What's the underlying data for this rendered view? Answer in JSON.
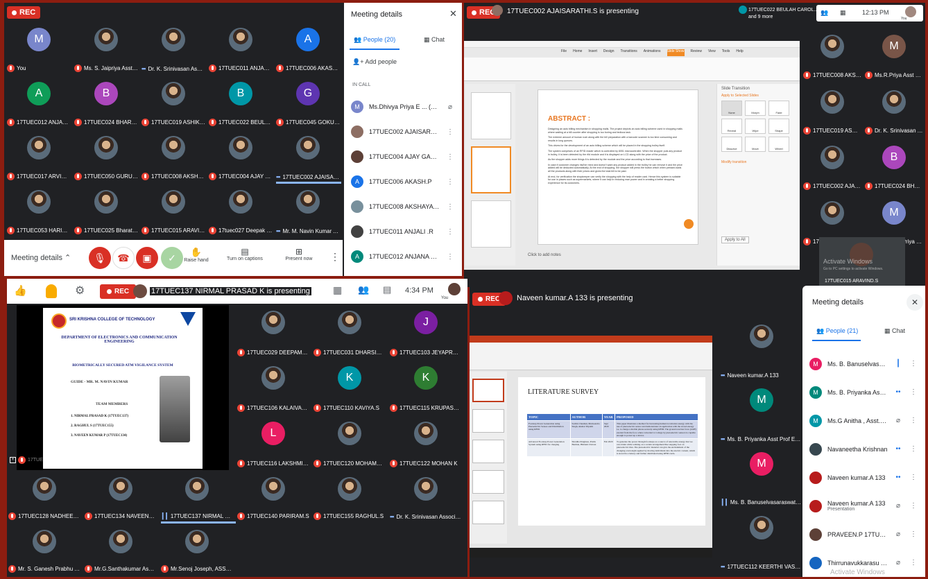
{
  "q1": {
    "rec": "REC",
    "meeting_details": "Meeting details",
    "side_title": "Meeting details",
    "people_tab": "People (20)",
    "chat_tab": "Chat",
    "add_people": "Add people",
    "in_call": "IN CALL",
    "people": [
      {
        "name": "Ms.Dhivya Priya E ... (You)",
        "initial": "M",
        "color": "#7986cb"
      },
      {
        "name": "17TUEC002 AJAISARAT...",
        "initial": "",
        "color": "#8d6e63"
      },
      {
        "name": "17TUEC004 AJAY GAUT...",
        "initial": "",
        "color": "#5d4037"
      },
      {
        "name": "17TUEC006 AKASH.P",
        "initial": "A",
        "color": "#1a73e8"
      },
      {
        "name": "17TUEC008 AKSHAYA K...",
        "initial": "",
        "color": "#78909c"
      },
      {
        "name": "17TUEC011 ANJALI .R",
        "initial": "",
        "color": "#424242"
      },
      {
        "name": "17TUEC012 ANJANA ME...",
        "initial": "A",
        "color": "#00897b"
      }
    ],
    "tiles": [
      {
        "name": "You",
        "initial": "M",
        "color": "#7986cb",
        "ind": "mic"
      },
      {
        "name": "Ms. S. Jaipriya Asst Pr...",
        "initial": "",
        "color": "",
        "ind": "mic"
      },
      {
        "name": "Dr. K. Srinivasan Asso...",
        "initial": "",
        "color": "",
        "ind": "dots"
      },
      {
        "name": "17TUEC011 ANJALI .R",
        "initial": "",
        "color": "",
        "ind": "mic"
      },
      {
        "name": "17TUEC006 AKASH.P",
        "initial": "A",
        "color": "#1a73e8",
        "ind": "mic"
      },
      {
        "name": "17TUEC012 ANJANA ...",
        "initial": "A",
        "color": "#0f9d58",
        "ind": "mic"
      },
      {
        "name": "17TUEC024 BHARATH...",
        "initial": "B",
        "color": "#ab47bc",
        "ind": "mic"
      },
      {
        "name": "17TUEC019 ASHIKHA.E",
        "initial": "",
        "color": "",
        "ind": "mic"
      },
      {
        "name": "17TUEC022 BEULAH ...",
        "initial": "B",
        "color": "#0097a7",
        "ind": "mic"
      },
      {
        "name": "17TUEC045 GOKUL R...",
        "initial": "G",
        "color": "#5e35b1",
        "ind": "mic"
      },
      {
        "name": "17TUEC017 ARVIND.P",
        "initial": "",
        "color": "",
        "ind": "mic"
      },
      {
        "name": "17TUEC050 GURUVIS...",
        "initial": "",
        "color": "",
        "ind": "mic"
      },
      {
        "name": "17TUEC008 AKSHAYA...",
        "initial": "",
        "color": "",
        "ind": "mic"
      },
      {
        "name": "17TUEC004 AJAY GA...",
        "initial": "",
        "color": "",
        "ind": "mic"
      },
      {
        "name": "17TUEC002 AJAISAR...",
        "initial": "",
        "color": "",
        "ind": "dots"
      },
      {
        "name": "17TUEC053 HARISH B...",
        "initial": "",
        "color": "",
        "ind": "mic"
      },
      {
        "name": "17TUEC025 Bharathi.G",
        "initial": "",
        "color": "",
        "ind": "mic"
      },
      {
        "name": "17TUEC015 ARAVIND.S",
        "initial": "",
        "color": "",
        "ind": "mic"
      },
      {
        "name": "17tuec027 Deepak no...",
        "initial": "",
        "color": "",
        "ind": "mic"
      },
      {
        "name": "Mr. M. Navin Kumar A...",
        "initial": "",
        "color": "",
        "ind": "dots"
      }
    ],
    "controls": {
      "raise": "Raise hand",
      "captions": "Turn on captions",
      "present": "Present now"
    }
  },
  "q2": {
    "rec": "REC",
    "presenting": "17TUEC002 AJAISARATHI.S is presenting",
    "top_person": "17TUEC022 BEULAH CAROL...",
    "top_more": "and 9 more",
    "time": "12:13 PM",
    "you": "You",
    "slide_title": "ABSTRACT :",
    "bullets": [
      "Designing an auto billing mechanism in shopping malls. The project depicts an auto billing scheme used in shopping malls where waiting at a bill counter after shopping is too boring and tedious task.",
      "The extreme amount of human rush along with the bill preparation with a barcode scanner is too time consuming and results in long queues.",
      "This drives for the development of an auto billing scheme which will be placed in the shopping trolley itself.",
      "The system comprises of an RFID reader which is controlled by 8051 microcontroller. When the shopper puts any product in trolley, it is been detected by the rfid module and it is displayed on LCD along with the price of the product.",
      "As the shopper adds more things it is detected by the module and the price according to that increases.",
      "In case if customer changes his/her mind and doesn't want any product added in the trolley he can remove it and the price added will be deducted automatically. At the end of shopping, the shopper will press the button which when pressed adds all the products along with their prices and gives the total bill to be paid.",
      "At end, for verification the shopkeeper can verify the shopping with the help of reader card. Hence this system is suitable for use in places such as supermarkets, where it can help in reducing man power and in creating a better shopping experience for its customers."
    ],
    "ribbon_tabs": [
      "File",
      "Home",
      "Insert",
      "Design",
      "Transitions",
      "Animations",
      "Slide Show",
      "Review",
      "View",
      "Tools",
      "Help"
    ],
    "notes": "Click to add notes",
    "pane_title": "Slide Transition",
    "apply_label": "Apply to Selected Slides",
    "transitions": [
      "None",
      "Morph",
      "Fade",
      "Reveal",
      "Wipe",
      "Shape",
      "Dissolve",
      "Move",
      "Wheel"
    ],
    "modify": "Modify transition",
    "apply_all": "Apply to All",
    "tiles": [
      {
        "name": "17TUEC008 AKSHAYA ...",
        "initial": "",
        "color": "",
        "ind": "mic"
      },
      {
        "name": "Ms.R.Priya Asst Prof E...",
        "initial": "M",
        "color": "#795548",
        "ind": "mic"
      },
      {
        "name": "17TUEC019 ASHIKHA.E",
        "initial": "",
        "color": "",
        "ind": "mic"
      },
      {
        "name": "Dr. K. Srinivasan Associ...",
        "initial": "",
        "color": "",
        "ind": "mic"
      },
      {
        "name": "17TUEC002 AJAISARA...",
        "initial": "",
        "color": "",
        "ind": "mic"
      },
      {
        "name": "17TUEC024 BHARATH.P",
        "initial": "B",
        "color": "#ab47bc",
        "ind": "mic"
      },
      {
        "name": "17TUEC053 HARISH B...",
        "initial": "",
        "color": "",
        "ind": "mic"
      },
      {
        "name": "Ms Dhivya Priya E L As...",
        "initial": "M",
        "color": "#7986cb",
        "ind": "mic"
      }
    ],
    "bottom_tile": "17TUEC015 ARAVIND.S",
    "activate": "Activate Windows",
    "activate_sub": "Go to PC settings to activate Windows."
  },
  "q3": {
    "rec": "REC",
    "presenting": "17TUEC137 NIRMAL PRASAD K is presenting",
    "time": "4:34 PM",
    "you": "You",
    "college": "SRI KRISHNA COLLEGE OF TECHNOLOGY",
    "dept": "DEPARTMENT OF ELECTRONICS AND COMMUNICATION ENGINEERING",
    "project": "BIOMETRICALLY SECURED ATM VIGILANCE SYSTEM",
    "guide": "GUIDE - MR. M. NAVIN KUMAR",
    "team_title": "TEAM MEMBERS",
    "team": [
      "1.  NIRMAL PRASAD K (17TUEC137)",
      "2.  RAGHUL S (17TUEC155)",
      "3.  NAVEEN KUMAR P (17TUEC134)"
    ],
    "presenter_label": "17TUEC137 NIRMAL PRASAD K",
    "tiles": [
      {
        "name": "17TUEC029 DEEPAMURU...",
        "initial": "",
        "color": "",
        "ind": "mic"
      },
      {
        "name": "17TUEC031 DHARSINI.B",
        "initial": "",
        "color": "",
        "ind": "mic"
      },
      {
        "name": "17TUEC103 JEYAPRABHA...",
        "initial": "J",
        "color": "#7b1fa2",
        "ind": "mic"
      },
      {
        "name": "17TUEC106 KALAIVANI.K",
        "initial": "",
        "color": "",
        "ind": "mic"
      },
      {
        "name": "17TUEC110 KAVIYA.S",
        "initial": "K",
        "color": "#0097a7",
        "ind": "mic"
      },
      {
        "name": "17TUEC115 KRUPASREE.P",
        "initial": "K",
        "color": "#2e7d32",
        "ind": "mic"
      },
      {
        "name": "17TUEC116 LAKSHMI PR...",
        "initial": "L",
        "color": "#e91e63",
        "ind": "mic"
      },
      {
        "name": "17TUEC120 MOHAMED FI...",
        "initial": "",
        "color": "",
        "ind": "mic"
      },
      {
        "name": "17TUEC122 MOHAN K",
        "initial": "",
        "color": "",
        "ind": "mic"
      },
      {
        "name": "17TUEC128 NADHEERA.M",
        "initial": "",
        "color": "",
        "ind": "mic"
      },
      {
        "name": "17TUEC134 NAVEENKUM...",
        "initial": "",
        "color": "",
        "ind": "mic"
      },
      {
        "name": "17TUEC137 NIRMAL PRA...",
        "initial": "",
        "color": "",
        "ind": "bars"
      },
      {
        "name": "17TUEC140 PARIRAM.S",
        "initial": "",
        "color": "",
        "ind": "mic"
      },
      {
        "name": "17TUEC155 RAGHUL.S",
        "initial": "",
        "color": "",
        "ind": "mic"
      },
      {
        "name": "Dr. K. Srinivasan Associate...",
        "initial": "",
        "color": "",
        "ind": "dots"
      },
      {
        "name": "Mr. S. Ganesh Prabhu Asst...",
        "initial": "",
        "color": "",
        "ind": "mic"
      },
      {
        "name": "Mr.G.Santhakumar Asst Pr...",
        "initial": "",
        "color": "",
        "ind": "mic"
      },
      {
        "name": "Mr.Senoj Joseph, ASST. P...",
        "initial": "",
        "color": "",
        "ind": "mic"
      }
    ]
  },
  "q4": {
    "rec": "REC",
    "presenting": "Naveen kumar.A 133 is presenting",
    "slide_title": "LITERATURE SURVEY",
    "table_head": [
      "TOPIC",
      "AUTHOR",
      "YEAR",
      "PROPOSED"
    ],
    "table_rows": [
      [
        "Footstep Power Generation using Piezoelectric Sensor and Distribution using RFID",
        "Sachin Chauhan, Manwendra Singh, Akshat Tripathi",
        "Sept 2020",
        "This paper illustrates a method for harvesting human locomotion energy with the use of piezoelectric sensor and demonstrates an application with the stored energy i.e. to charge a mobile phone securely using RFID. The ground reaction force (GRF) exerted from the foot, when converted to voltage by piezoelectric sensors is capable enough to power up a device."
      ],
      [
        "Advanced Footstep Power Generation System using RFID for charging",
        "Shradha Panghare, Pratik Barman, Himanti Chavan",
        "Feb 2020",
        "To generate the power through footsteps as a source of renewable energy that we can obtain while walking on a certain arrangement like stepping foot on piezoelectric tiles. The piezoelectric material can give the enchantment of the changing overweight applied by moving individuals into the electric current, which is stored in a battery and further distributed using RFID cards."
      ]
    ],
    "side_title": "Meeting details",
    "people_tab": "People (21)",
    "chat_tab": "Chat",
    "people": [
      {
        "name": "Ms. B. Banuselvasarasw...",
        "initial": "M",
        "color": "#e91e63",
        "ind": "bars"
      },
      {
        "name": "Ms. B. Priyanka Asst Pro...",
        "initial": "M",
        "color": "#00897b",
        "ind": "dots"
      },
      {
        "name": "Ms.G Anitha , Asst. Prof.",
        "initial": "M",
        "color": "#0097a7",
        "ind": "mic"
      },
      {
        "name": "Navaneetha Krishnan",
        "initial": "",
        "color": "#37474f",
        "ind": "dots"
      },
      {
        "name": "Naveen kumar.A 133",
        "initial": "",
        "color": "#b71c1c",
        "ind": "dots"
      },
      {
        "name": "Naveen kumar.A 133",
        "sub": "Presentation",
        "initial": "",
        "color": "#b71c1c",
        "ind": "mic"
      },
      {
        "name": "PRAVEEN.P 17TUEC150",
        "initial": "",
        "color": "#5d4037",
        "ind": "mic"
      },
      {
        "name": "Thirrunavukkarasu R R",
        "initial": "",
        "color": "#1565c0",
        "ind": "mic"
      }
    ],
    "activate": "Activate Windows",
    "tiles": [
      {
        "name": "Naveen kumar.A 133",
        "initial": "",
        "color": "#b71c1c",
        "ind": "dots"
      },
      {
        "name": "Ms. B. Priyanka Asst Prof ECE",
        "initial": "M",
        "color": "#00897b",
        "ind": "dots"
      },
      {
        "name": "Ms. B. Banuselvasaraswathy A...",
        "initial": "M",
        "color": "#e91e63",
        "ind": "bars"
      },
      {
        "name": "17TUEC112 KEERTHI VASAN.G",
        "initial": "",
        "color": "#bf360c",
        "ind": "dots"
      }
    ]
  }
}
